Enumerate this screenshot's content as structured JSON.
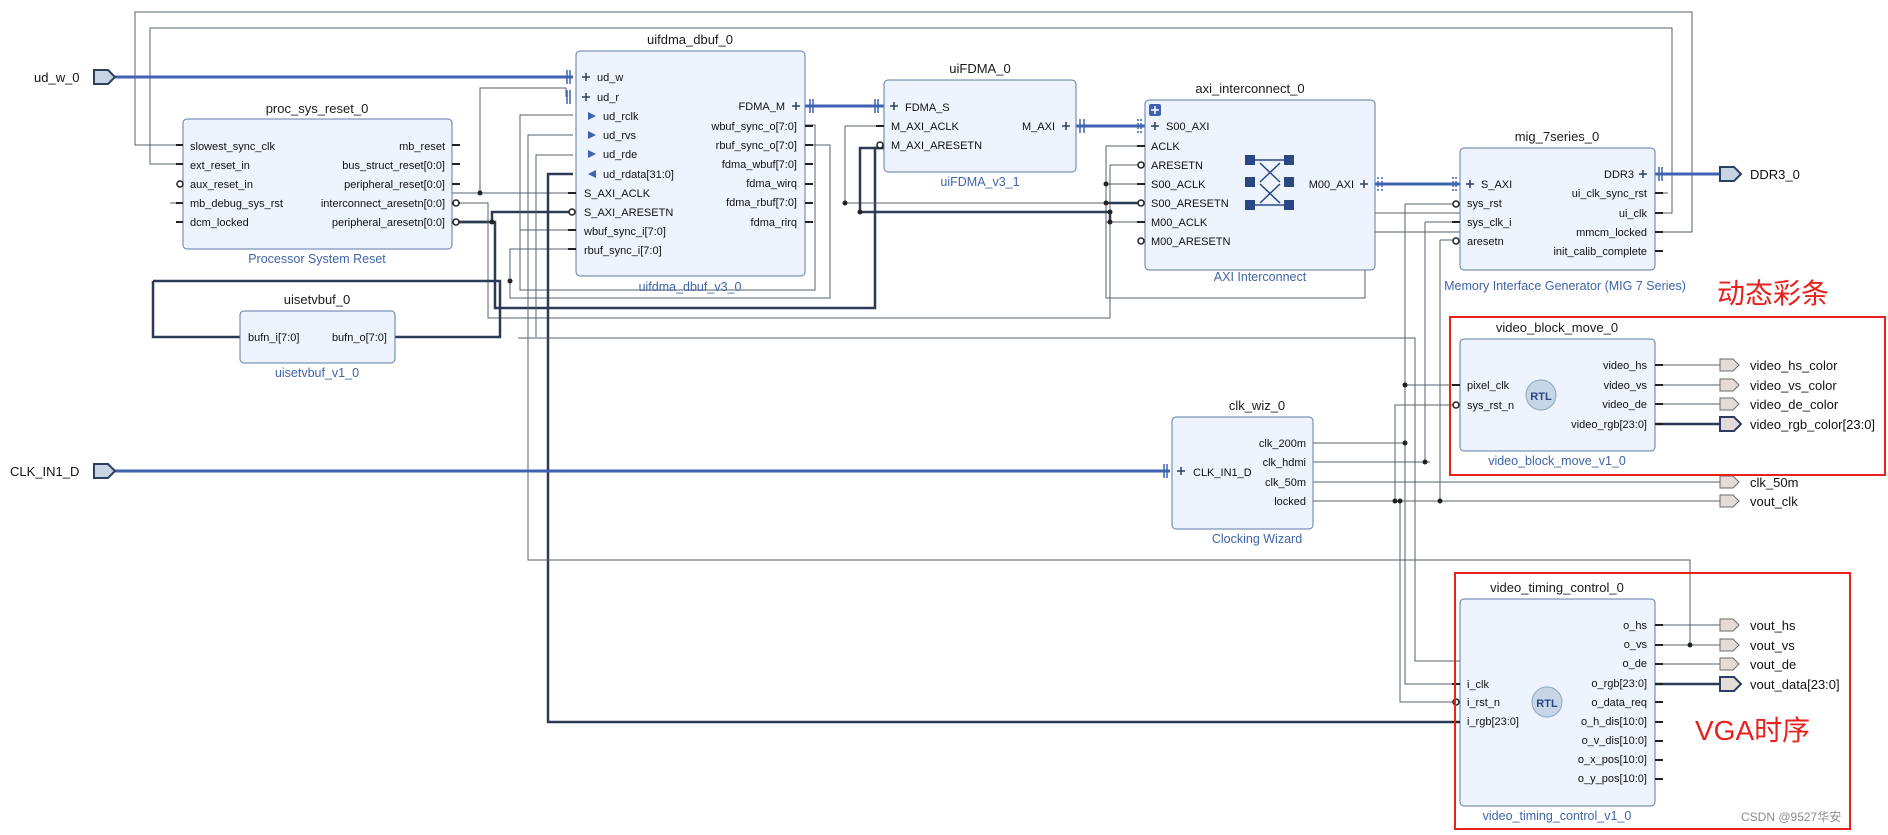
{
  "ext_inputs": {
    "ud_w": "ud_w_0",
    "clk_in": "CLK_IN1_D"
  },
  "ext_outputs": {
    "ddr3": "DDR3_0",
    "vbm": [
      "video_hs_color",
      "video_vs_color",
      "video_de_color",
      "video_rgb_color[23:0]"
    ],
    "clk_50m": "clk_50m",
    "vout_clk": "vout_clk",
    "vtc": [
      "vout_hs",
      "vout_vs",
      "vout_de",
      "vout_data[23:0]"
    ]
  },
  "blocks": {
    "psr": {
      "name": "proc_sys_reset_0",
      "subtitle": "Processor System Reset",
      "in": [
        "slowest_sync_clk",
        "ext_reset_in",
        "aux_reset_in",
        "mb_debug_sys_rst",
        "dcm_locked"
      ],
      "out": [
        "mb_reset",
        "bus_struct_reset[0:0]",
        "peripheral_reset[0:0]",
        "interconnect_aresetn[0:0]",
        "peripheral_aresetn[0:0]"
      ]
    },
    "uifdma": {
      "name": "uifdma_dbuf_0",
      "subtitle": "uifdma_dbuf_v3_0",
      "in": [
        "ud_w",
        "ud_r",
        "ud_rclk",
        "ud_rvs",
        "ud_rde",
        "ud_rdata[31:0]",
        "S_AXI_ACLK",
        "S_AXI_ARESETN",
        "wbuf_sync_i[7:0]",
        "rbuf_sync_i[7:0]"
      ],
      "out": [
        "FDMA_M",
        "wbuf_sync_o[7:0]",
        "rbuf_sync_o[7:0]",
        "fdma_wbuf[7:0]",
        "fdma_wirq",
        "fdma_rbuf[7:0]",
        "fdma_rirq"
      ]
    },
    "fdma": {
      "name": "uiFDMA_0",
      "subtitle": "uiFDMA_v3_1",
      "in": [
        "FDMA_S",
        "M_AXI_ACLK",
        "M_AXI_ARESETN"
      ],
      "out": [
        "M_AXI"
      ]
    },
    "axi": {
      "name": "axi_interconnect_0",
      "subtitle": "AXI Interconnect",
      "in": [
        "S00_AXI",
        "ACLK",
        "ARESETN",
        "S00_ACLK",
        "S00_ARESETN",
        "M00_ACLK",
        "M00_ARESETN"
      ],
      "out": [
        "M00_AXI"
      ]
    },
    "mig": {
      "name": "mig_7series_0",
      "subtitle": "Memory Interface Generator (MIG 7 Series)",
      "in": [
        "S_AXI",
        "sys_rst",
        "sys_clk_i",
        "aresetn"
      ],
      "out": [
        "DDR3",
        "ui_clk_sync_rst",
        "ui_clk",
        "mmcm_locked",
        "init_calib_complete"
      ]
    },
    "uisetv": {
      "name": "uisetvbuf_0",
      "subtitle": "uisetvbuf_v1_0",
      "in": [
        "bufn_i[7:0]"
      ],
      "out": [
        "bufn_o[7:0]"
      ]
    },
    "vbm": {
      "name": "video_block_move_0",
      "subtitle": "video_block_move_v1_0",
      "badge": "RTL",
      "in": [
        "pixel_clk",
        "sys_rst_n"
      ],
      "out": [
        "video_hs",
        "video_vs",
        "video_de",
        "video_rgb[23:0]"
      ]
    },
    "clkwiz": {
      "name": "clk_wiz_0",
      "subtitle": "Clocking Wizard",
      "in": [
        "CLK_IN1_D"
      ],
      "out": [
        "clk_200m",
        "clk_hdmi",
        "clk_50m",
        "locked"
      ]
    },
    "vtc": {
      "name": "video_timing_control_0",
      "subtitle": "video_timing_control_v1_0",
      "badge": "RTL",
      "in": [
        "i_clk",
        "i_rst_n",
        "i_rgb[23:0]"
      ],
      "out": [
        "o_hs",
        "o_vs",
        "o_de",
        "o_rgb[23:0]",
        "o_data_req",
        "o_h_dis[10:0]",
        "o_v_dis[10:0]",
        "o_x_pos[10:0]",
        "o_y_pos[10:0]"
      ]
    }
  },
  "annotations": {
    "vbm": "动态彩条",
    "vtc": "VGA时序"
  },
  "watermark": "CSDN @9527华安"
}
